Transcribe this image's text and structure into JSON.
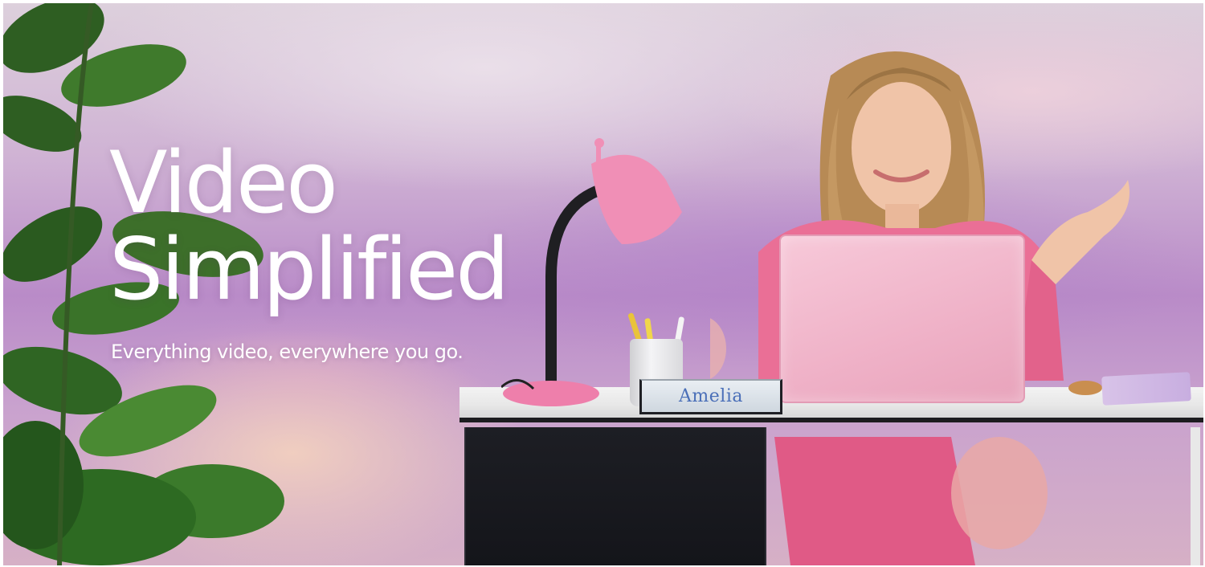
{
  "hero": {
    "headline_line1": "Video",
    "headline_line2": "Simplified",
    "tagline": "Everything video, everywhere you go.",
    "nameplate_text": "Amelia"
  },
  "colors": {
    "headline": "#ffffff",
    "accent_pink": "#f08fb6",
    "laptop_pink": "#efb1c7",
    "desk_black": "#16171c",
    "nameplate_text": "#4a6fb8"
  },
  "icons": [
    "plant-illustration",
    "desk-lamp-illustration",
    "laptop-illustration",
    "person-illustration"
  ]
}
